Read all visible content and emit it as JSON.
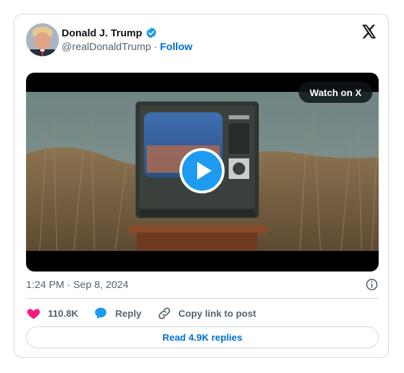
{
  "author": {
    "display_name": "Donald J. Trump",
    "handle": "@realDonaldTrump",
    "separator": "·",
    "follow_label": "Follow"
  },
  "media": {
    "watch_label": "Watch on X"
  },
  "meta": {
    "time": "1:24 PM",
    "separator": "·",
    "date": "Sep 8, 2024"
  },
  "actions": {
    "like_count": "110.8K",
    "reply_label": "Reply",
    "copy_label": "Copy link to post"
  },
  "footer": {
    "read_replies_label": "Read 4.9K replies"
  },
  "colors": {
    "accent": "#006fd6",
    "verified": "#1d9bf0",
    "like": "#f91880",
    "border": "#cfd9de",
    "secondary_text": "#536471"
  },
  "icons": [
    "verified-badge-icon",
    "x-logo-icon",
    "play-icon",
    "info-icon",
    "heart-icon",
    "reply-bubble-icon",
    "link-icon"
  ]
}
